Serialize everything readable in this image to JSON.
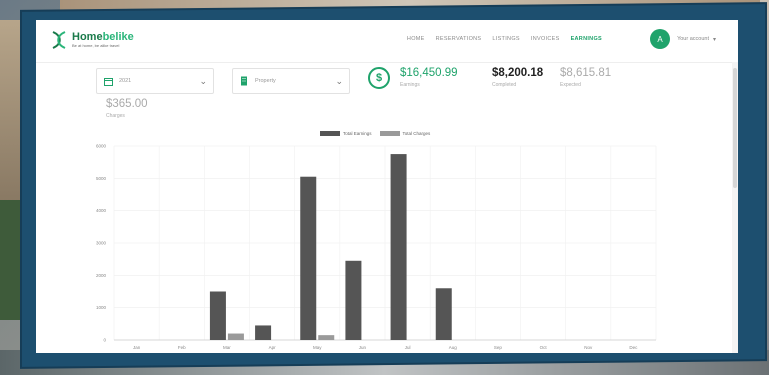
{
  "app": {
    "brand_name_a": "Home",
    "brand_name_b": "belike",
    "brand_tagline": "Be at home, be alike travel"
  },
  "nav": {
    "links": [
      "HOME",
      "RESERVATIONS",
      "LISTINGS",
      "INVOICES",
      "EARNINGS"
    ],
    "active": "EARNINGS"
  },
  "user": {
    "initial": "A",
    "name": "Your account"
  },
  "filters": {
    "year": "2021",
    "property": "Property"
  },
  "stats": {
    "earnings": {
      "value": "$16,450.99",
      "label": "Earnings"
    },
    "completed": {
      "value": "$8,200.18",
      "label": "Completed"
    },
    "expected": {
      "value": "$8,615.81",
      "label": "Expected"
    },
    "charges": {
      "value": "$365.00",
      "label": "Charges"
    }
  },
  "colors": {
    "accent": "#1fa36b",
    "earnings_bar": "#555555",
    "charges_bar": "#9a9a9a"
  },
  "chart_data": {
    "type": "bar",
    "categories": [
      "Jan",
      "Feb",
      "Mar",
      "Apr",
      "May",
      "Jun",
      "Jul",
      "Aug",
      "Sep",
      "Oct",
      "Nov",
      "Dec"
    ],
    "series": [
      {
        "name": "Total Earnings",
        "values": [
          0,
          0,
          1500,
          450,
          5050,
          2450,
          5750,
          1600,
          0,
          0,
          0,
          0
        ]
      },
      {
        "name": "Total Charges",
        "values": [
          0,
          0,
          200,
          0,
          150,
          0,
          0,
          0,
          0,
          0,
          0,
          0
        ]
      }
    ],
    "yticks": [
      0,
      1000,
      2000,
      3000,
      4000,
      5000,
      6000
    ],
    "ylim": [
      0,
      6000
    ],
    "legend_position": "top-center",
    "grid": true
  }
}
